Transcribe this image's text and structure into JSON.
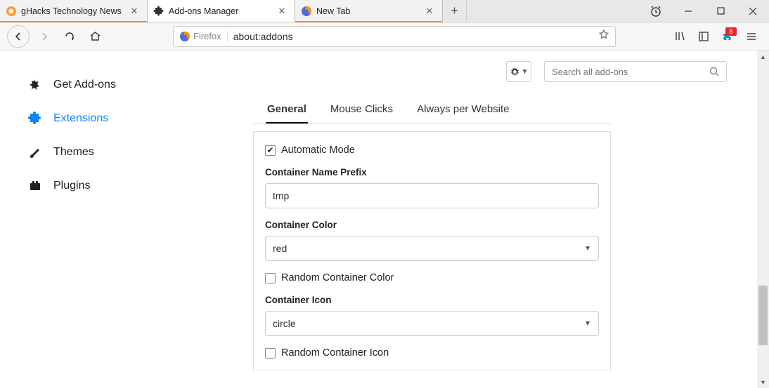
{
  "tabs": [
    {
      "label": "gHacks Technology News",
      "favicon": "ghacks"
    },
    {
      "label": "Add-ons Manager",
      "favicon": "puzzle"
    },
    {
      "label": "New Tab",
      "favicon": "firefox"
    }
  ],
  "identity_label": "Firefox",
  "url": "about:addons",
  "ext_badge": "8",
  "sidebar": {
    "getaddons": "Get Add-ons",
    "extensions": "Extensions",
    "themes": "Themes",
    "plugins": "Plugins"
  },
  "search_placeholder": "Search all add-ons",
  "option_tabs": {
    "general": "General",
    "mouse": "Mouse Clicks",
    "always": "Always per Website"
  },
  "general": {
    "automatic_mode": "Automatic Mode",
    "prefix_label": "Container Name Prefix",
    "prefix_value": "tmp",
    "color_label": "Container Color",
    "color_value": "red",
    "random_color": "Random Container Color",
    "icon_label": "Container Icon",
    "icon_value": "circle",
    "random_icon": "Random Container Icon"
  }
}
